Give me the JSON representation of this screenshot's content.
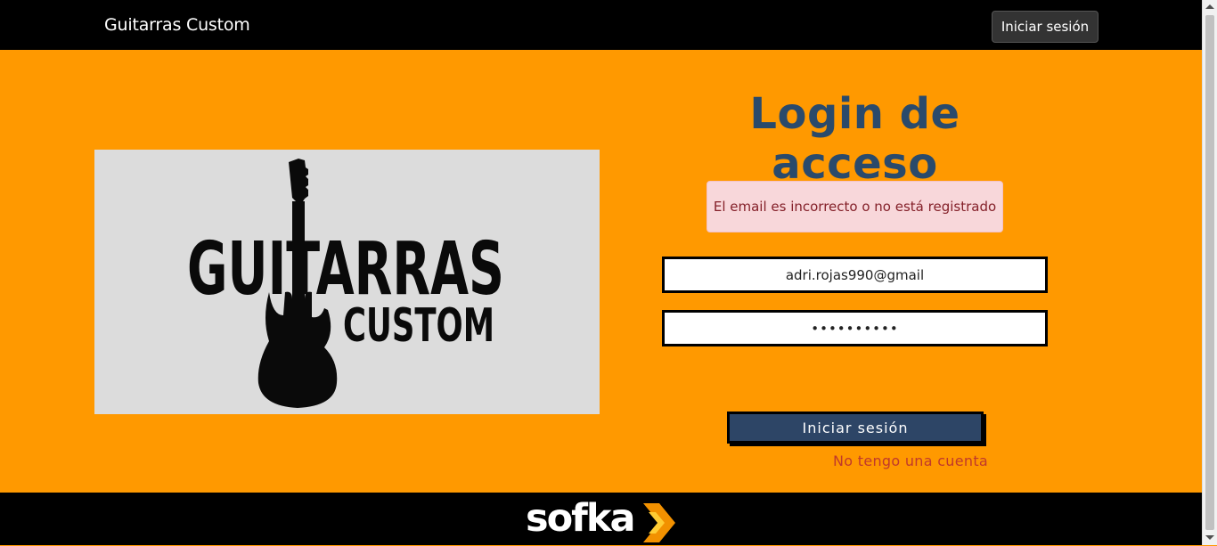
{
  "navbar": {
    "brand": "Guitarras Custom",
    "login_button": "Iniciar sesión"
  },
  "hero_logo": {
    "line1": "GUITARRAS",
    "line2": "CUSTOM"
  },
  "login": {
    "title": "Login de acceso",
    "error_alert": "El email es incorrecto o no está registrado",
    "email_value": "adri.rojas990@gmail",
    "password_value": "••••••••••",
    "submit_label": "Iniciar sesión",
    "no_account_link": "No tengo una cuenta"
  },
  "footer": {
    "brand": "sofka"
  },
  "colors": {
    "page_bg": "#ff9900",
    "nav_bg": "#000000",
    "title": "#2a4a6b",
    "alert_bg": "#f8d7da",
    "alert_text": "#842029",
    "submit_bg": "#2d4566",
    "link": "#c0392b",
    "sofka_accent": "#f29100"
  }
}
